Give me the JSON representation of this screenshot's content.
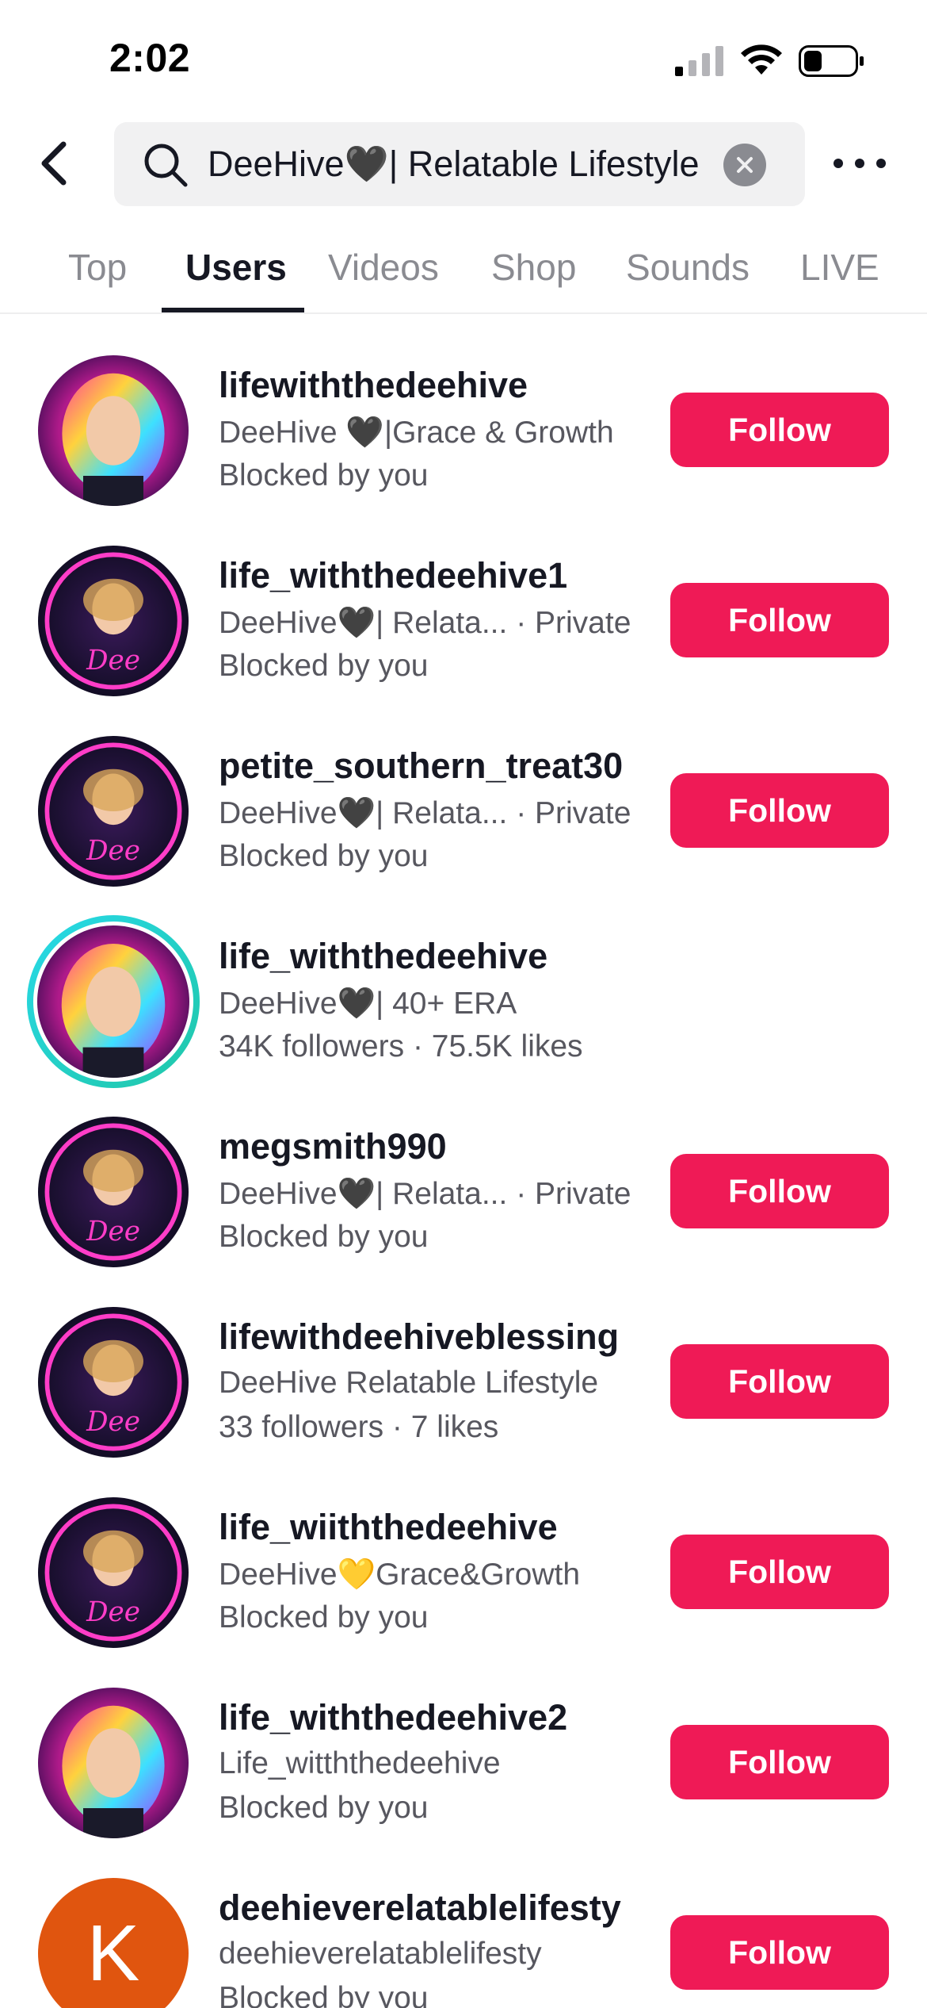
{
  "status_bar": {
    "time": "2:02"
  },
  "search": {
    "query": "DeeHive🖤| Relatable Lifestyle"
  },
  "tabs": [
    {
      "label": "Top",
      "active": false
    },
    {
      "label": "Users",
      "active": true
    },
    {
      "label": "Videos",
      "active": false
    },
    {
      "label": "Shop",
      "active": false
    },
    {
      "label": "Sounds",
      "active": false
    },
    {
      "label": "LIVE",
      "active": false
    }
  ],
  "users": [
    {
      "username": "lifewiththedeehive",
      "nickname": "DeeHive 🖤|Grace & Growth",
      "private": "",
      "meta": "Blocked by you",
      "button": "Follow",
      "avatar": "neon-portrait-rainbow-hair"
    },
    {
      "username": "life_withthedeehive1",
      "nickname": "DeeHive🖤| Relata...",
      "private": "· Private",
      "meta": "Blocked by you",
      "button": "Follow",
      "avatar": "deehive-live-host-logo"
    },
    {
      "username": "petite_southern_treat30",
      "nickname": "DeeHive🖤| Relata...",
      "private": "· Private",
      "meta": "Blocked by you",
      "button": "Follow",
      "avatar": "deehive-live-host-logo"
    },
    {
      "username": "life_withthedeehive",
      "nickname": "DeeHive🖤| 40+ ERA",
      "private": "",
      "meta": "34K followers · 75.5K likes",
      "button": "",
      "avatar": "neon-portrait-live-ring"
    },
    {
      "username": "megsmith990",
      "nickname": "DeeHive🖤| Relata...",
      "private": "· Private",
      "meta": "Blocked by you",
      "button": "Follow",
      "avatar": "deehive-live-host-logo"
    },
    {
      "username": "lifewithdeehiveblessing",
      "nickname": "DeeHive Relatable Lifestyle",
      "private": "",
      "meta": "33 followers · 7 likes",
      "button": "Follow",
      "avatar": "deehive-live-host-logo"
    },
    {
      "username": "life_wiiththedeehive",
      "nickname": "DeeHive💛Grace&Growth",
      "private": "",
      "meta": "Blocked by you",
      "button": "Follow",
      "avatar": "deehive-live-host-logo"
    },
    {
      "username": "life_withthedeehive2",
      "nickname": "Life_witththedeehive",
      "private": "",
      "meta": "Blocked by you",
      "button": "Follow",
      "avatar": "neon-portrait-rainbow-hair"
    },
    {
      "username": "deehieverelatablelifesty",
      "nickname": "deehieverelatablelifesty",
      "private": "",
      "meta": "Blocked by you",
      "button": "Follow",
      "avatar": "letter-k",
      "avatar_letter": "K"
    }
  ],
  "colors": {
    "follow": "#ef1a56",
    "text_primary": "#161823",
    "text_secondary": "#57575f",
    "live_ring": "#28d9e8",
    "letter_avatar": "#e0550f"
  }
}
